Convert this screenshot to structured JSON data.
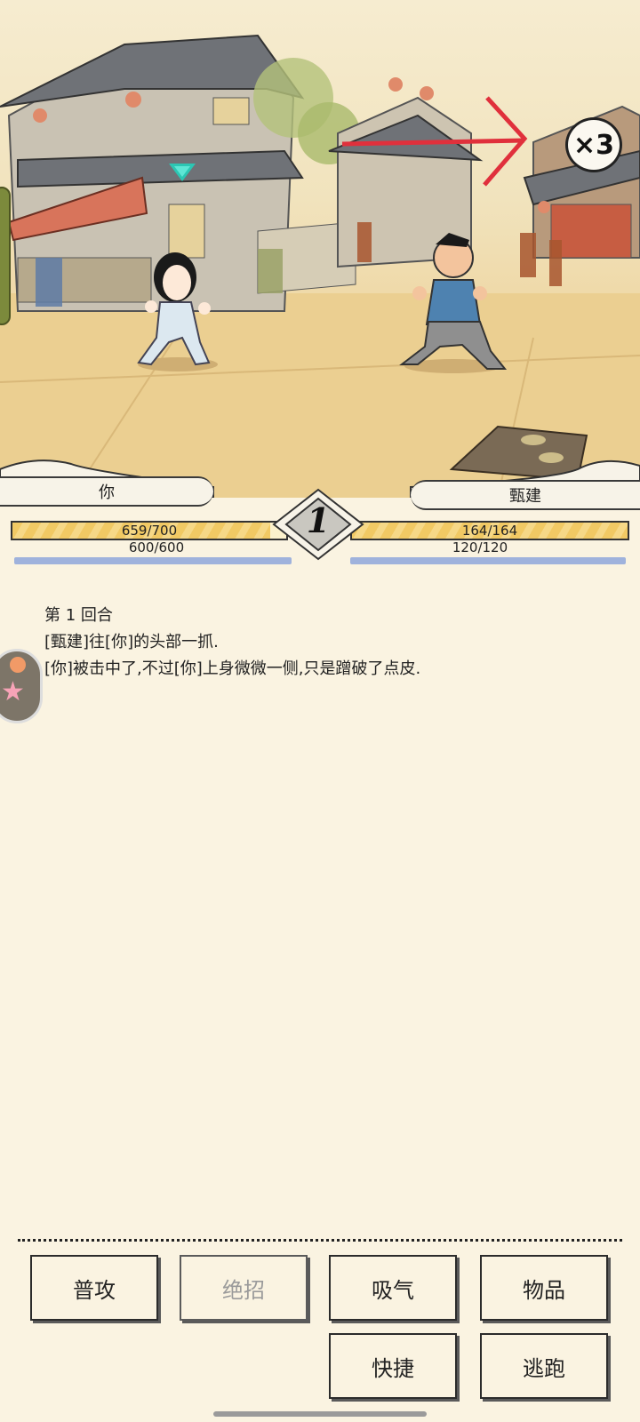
{
  "scene": {
    "speed_label": "×3",
    "accent_arrow_color": "#e0303c",
    "marker_color": "#2cc6b3"
  },
  "player": {
    "name": "你",
    "hp_text": "659/700",
    "hp_fraction": 0.941,
    "mp_text": "600/600",
    "mp_fraction": 1.0
  },
  "enemy": {
    "name": "甄建",
    "hp_text": "164/164",
    "hp_fraction": 1.0,
    "mp_text": "120/120",
    "mp_fraction": 1.0
  },
  "round_number": "1",
  "log": {
    "lines": [
      "第 1 回合",
      "[甄建]往[你]的头部一抓.",
      "[你]被击中了,不过[你]上身微微一侧,只是蹭破了点皮."
    ]
  },
  "actions": {
    "attack": "普攻",
    "ultimate": "绝招",
    "breathe": "吸气",
    "items": "物品",
    "shortcut": "快捷",
    "flee": "逃跑"
  }
}
